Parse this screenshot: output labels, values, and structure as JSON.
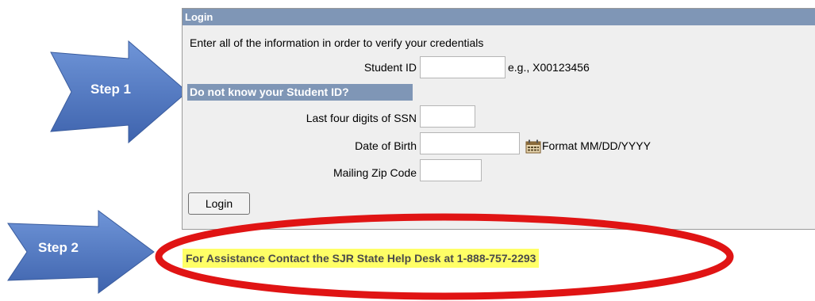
{
  "annotations": {
    "step1_label": "Step 1",
    "step2_label": "Step 2",
    "arrow_color": "#4f78c4",
    "ellipse_color": "#e01414"
  },
  "login_panel": {
    "title": "Login",
    "instructions": "Enter all of the information in order to verify your credentials",
    "student_id_label": "Student ID",
    "student_id_value": "",
    "student_id_hint": "e.g., X00123456",
    "unknown_id_header": "Do not know your Student ID?",
    "ssn_label": "Last four digits of SSN",
    "ssn_value": "",
    "dob_label": "Date of Birth",
    "dob_value": "",
    "dob_format_hint": "Format MM/DD/YYYY",
    "zip_label": "Mailing Zip Code",
    "zip_value": "",
    "login_button": "Login"
  },
  "assistance_text": "For Assistance Contact the SJR State Help Desk at 1-888-757-2293"
}
